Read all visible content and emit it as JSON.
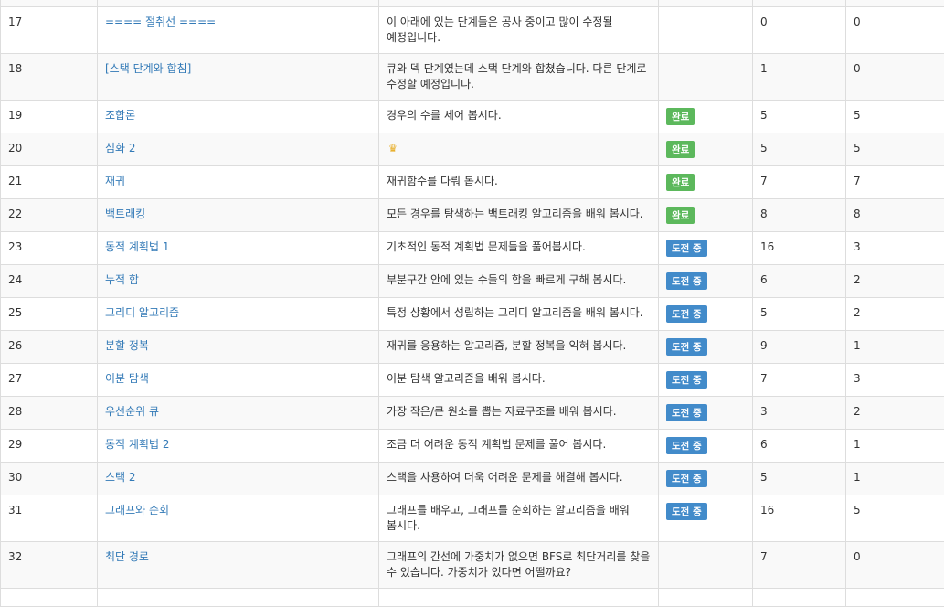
{
  "rows": [
    {
      "num": "",
      "title": "",
      "desc": "",
      "status": "",
      "a": "",
      "b": ""
    },
    {
      "num": "17",
      "title": "==== 절취선 ====",
      "desc": "이 아래에 있는 단계들은 공사 중이고 많이 수정될 예정입니다.",
      "status": "",
      "a": "0",
      "b": "0"
    },
    {
      "num": "18",
      "title": "[스택 단계와 합침]",
      "desc": "큐와 덱 단계였는데 스택 단계와 합쳤습니다. 다른 단계로 수정할 예정입니다.",
      "status": "",
      "a": "1",
      "b": "0"
    },
    {
      "num": "19",
      "title": "조합론",
      "desc": "경우의 수를 세어 봅시다.",
      "status": "완료",
      "a": "5",
      "b": "5"
    },
    {
      "num": "20",
      "title": "심화 2",
      "desc": "",
      "status": "완료",
      "a": "5",
      "b": "5"
    },
    {
      "num": "21",
      "title": "재귀",
      "desc": "재귀함수를 다뤄 봅시다.",
      "status": "완료",
      "a": "7",
      "b": "7"
    },
    {
      "num": "22",
      "title": "백트래킹",
      "desc": "모든 경우를 탐색하는 백트래킹 알고리즘을 배워 봅시다.",
      "status": "완료",
      "a": "8",
      "b": "8"
    },
    {
      "num": "23",
      "title": "동적 계획법 1",
      "desc": "기초적인 동적 계획법 문제들을 풀어봅시다.",
      "status": "도전 중",
      "a": "16",
      "b": "3"
    },
    {
      "num": "24",
      "title": "누적 합",
      "desc": "부분구간 안에 있는 수들의 합을 빠르게 구해 봅시다.",
      "status": "도전 중",
      "a": "6",
      "b": "2"
    },
    {
      "num": "25",
      "title": "그리디 알고리즘",
      "desc": "특정 상황에서 성립하는 그리디 알고리즘을 배워 봅시다.",
      "status": "도전 중",
      "a": "5",
      "b": "2"
    },
    {
      "num": "26",
      "title": "분할 정복",
      "desc": "재귀를 응용하는 알고리즘, 분할 정복을 익혀 봅시다.",
      "status": "도전 중",
      "a": "9",
      "b": "1"
    },
    {
      "num": "27",
      "title": "이분 탐색",
      "desc": "이분 탐색 알고리즘을 배워 봅시다.",
      "status": "도전 중",
      "a": "7",
      "b": "3"
    },
    {
      "num": "28",
      "title": "우선순위 큐",
      "desc": "가장 작은/큰 원소를 뽑는 자료구조를 배워 봅시다.",
      "status": "도전 중",
      "a": "3",
      "b": "2"
    },
    {
      "num": "29",
      "title": "동적 계획법 2",
      "desc": "조금 더 어려운 동적 계획법 문제를 풀어 봅시다.",
      "status": "도전 중",
      "a": "6",
      "b": "1"
    },
    {
      "num": "30",
      "title": "스택 2",
      "desc": "스택을 사용하여 더욱 어려운 문제를 해결해 봅시다.",
      "status": "도전 중",
      "a": "5",
      "b": "1"
    },
    {
      "num": "31",
      "title": "그래프와 순회",
      "desc": "그래프를 배우고, 그래프를 순회하는 알고리즘을 배워 봅시다.",
      "status": "도전 중",
      "a": "16",
      "b": "5"
    },
    {
      "num": "32",
      "title": "최단 경로",
      "desc": "그래프의 간선에 가중치가 없으면 BFS로 최단거리를 찾을 수 있습니다. 가중치가 있다면 어떨까요?",
      "status": "",
      "a": "7",
      "b": "0"
    },
    {
      "num": "",
      "title": "",
      "desc": "",
      "status": "",
      "a": "",
      "b": ""
    }
  ],
  "icons": {
    "row20_desc": "crown-icon"
  },
  "colors": {
    "done": "#5cb85c",
    "trying": "#428bca",
    "link": "#337ab7"
  }
}
